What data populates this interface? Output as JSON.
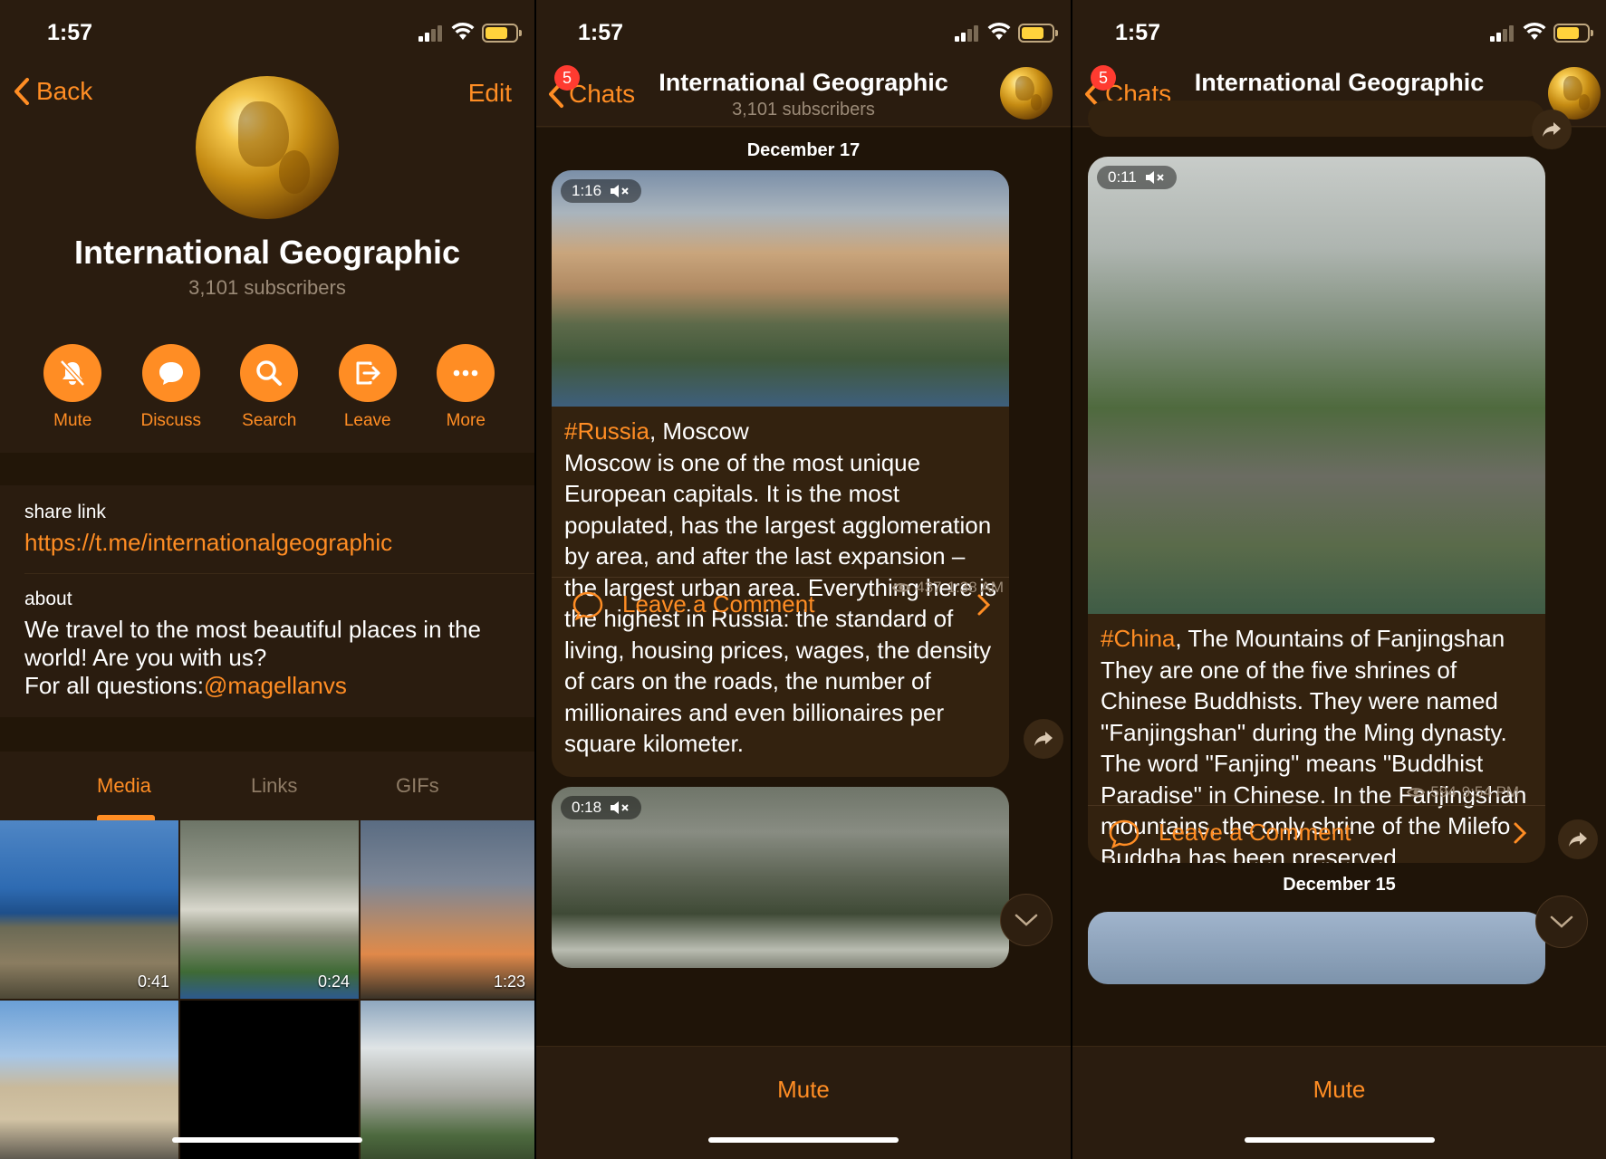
{
  "status": {
    "time": "1:57"
  },
  "profile": {
    "back_label": "Back",
    "edit_label": "Edit",
    "title": "International Geographic",
    "subtitle": "3,101 subscribers",
    "actions": [
      {
        "label": "Mute",
        "icon": "bell-slash-icon"
      },
      {
        "label": "Discuss",
        "icon": "chat-bubble-icon"
      },
      {
        "label": "Search",
        "icon": "search-icon"
      },
      {
        "label": "Leave",
        "icon": "leave-icon"
      },
      {
        "label": "More",
        "icon": "more-icon"
      }
    ],
    "share_label": "share link",
    "share_link": "https://t.me/internationalgeographic",
    "about_label": "about",
    "about_line1": "We travel to the most beautiful places in the world! Are you with us?",
    "about_line2": "For all questions:",
    "about_mention": "@magellanvs",
    "tabs": [
      "Media",
      "Links",
      "GIFs"
    ],
    "media_durations": [
      "0:41",
      "0:24",
      "1:23"
    ]
  },
  "chat": {
    "back_label": "Chats",
    "unread_badge": "5",
    "title": "International Geographic",
    "subtitle": "3,101 subscribers",
    "mute_label": "Mute",
    "comment_label": "Leave a Comment"
  },
  "screen2": {
    "date": "December 17",
    "post1": {
      "video_duration": "1:16",
      "tag": "#Russia",
      "heading_rest": ", Moscow",
      "body": "Moscow is one of the most unique European capitals. It is the most populated, has the largest agglomeration by area, and after the last expansion – the largest urban area. Everything here is the highest in Russia: the standard of living, housing prices, wages, the density of cars on the roads, the number of millionaires and even billionaires per square kilometer.",
      "views": "437",
      "time": "1:38 AM"
    },
    "post2": {
      "video_duration": "0:18"
    }
  },
  "screen3": {
    "post": {
      "video_duration": "0:11",
      "tag": "#China",
      "heading_rest": ", The Mountains of Fanjingshan",
      "body": "They are one of the five shrines of Chinese Buddhists. They were named \"Fanjingshan\" during the Ming dynasty. The word \"Fanjing\" means \"Buddhist Paradise\" in Chinese. In the Fanjingshan mountains, the only shrine of the Milefo Buddha has been preserved.",
      "views": "594",
      "time": "9:54 PM"
    },
    "date": "December 15"
  },
  "colors": {
    "accent": "#ff8d24",
    "background": "#2a1c0f",
    "badge": "#ff3b30"
  }
}
